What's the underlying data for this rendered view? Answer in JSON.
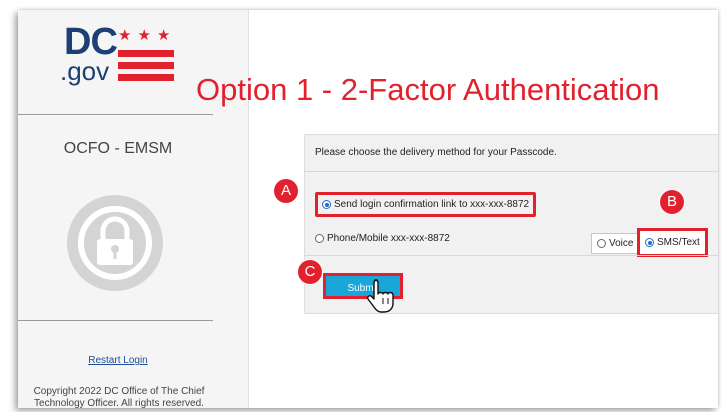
{
  "title_overlay": "Option 1 - 2-Factor Authentication",
  "sidebar": {
    "logo": {
      "dc": "DC",
      "gov": ".gov",
      "stars": "★★★"
    },
    "org_name": "OCFO - EMSM",
    "avatar_icon": "lock-icon",
    "restart_link": "Restart Login",
    "copyright": "Copyright 2022 DC Office of The Chief Technology Officer. All rights reserved."
  },
  "form": {
    "instruction": "Please choose the delivery method for your Passcode.",
    "options": {
      "link": {
        "label": "Send login confirmation link to xxx-xxx-8872",
        "selected": true
      },
      "phone": {
        "label": "Phone/Mobile xxx-xxx-8872",
        "selected": false
      },
      "voice": {
        "label": "Voice",
        "selected": false
      },
      "sms": {
        "label": "SMS/Text",
        "selected": true
      }
    },
    "submit_label": "Submit"
  },
  "callouts": {
    "a": "A",
    "b": "B",
    "c": "C"
  },
  "colors": {
    "annotation": "#e2212e",
    "logo_blue": "#1e3f73",
    "button": "#1aa6d9",
    "radio_selected": "#1a6fd0"
  }
}
